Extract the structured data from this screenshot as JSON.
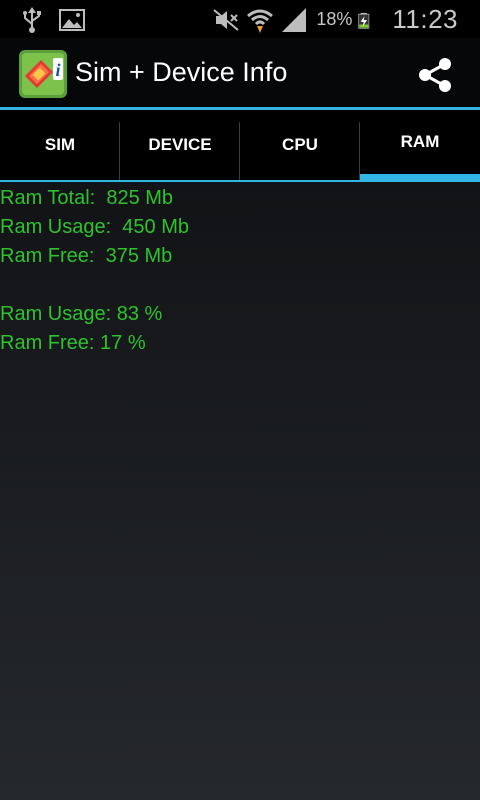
{
  "status_bar": {
    "battery_percent": "18%",
    "time": "11:23",
    "icons": [
      "usb-icon",
      "image-icon",
      "mute-icon",
      "wifi-icon",
      "signal-icon",
      "battery-charging-icon"
    ]
  },
  "app": {
    "title": "Sim + Device Info",
    "icon": "sim-info-icon",
    "share_icon": "share-icon"
  },
  "tabs": [
    {
      "label": "SIM",
      "selected": false
    },
    {
      "label": "DEVICE",
      "selected": false
    },
    {
      "label": "CPU",
      "selected": false
    },
    {
      "label": "RAM",
      "selected": true
    }
  ],
  "ram_info": {
    "total": "Ram Total:  825 Mb",
    "usage": "Ram Usage:  450 Mb",
    "free": "Ram Free:  375 Mb",
    "usage_pct": "Ram Usage: 83 %",
    "free_pct": "Ram Free: 17 %"
  },
  "colors": {
    "accent": "#33b5e5",
    "text_green": "#2fc22f"
  }
}
